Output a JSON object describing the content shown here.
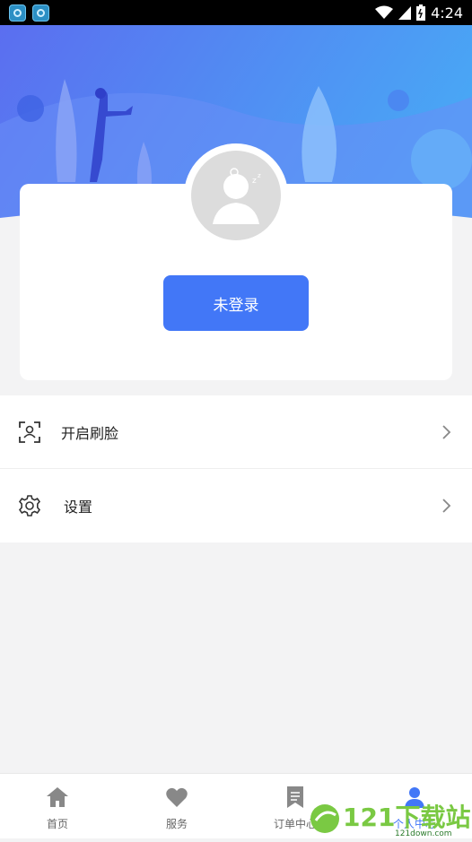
{
  "status_bar": {
    "time": "4:24"
  },
  "profile": {
    "login_button_label": "未登录"
  },
  "menu": {
    "items": [
      {
        "label": "开启刷脸",
        "icon": "face-scan-icon"
      },
      {
        "label": "设置",
        "icon": "gear-icon"
      }
    ]
  },
  "tabbar": {
    "tabs": [
      {
        "label": "首页",
        "icon": "home-icon"
      },
      {
        "label": "服务",
        "icon": "heart-icon"
      },
      {
        "label": "订单中心",
        "icon": "order-icon"
      },
      {
        "label": "个人中心",
        "icon": "person-icon",
        "active": true
      }
    ]
  },
  "watermark": {
    "text": "121下载站",
    "subtext": "121down.com"
  },
  "colors": {
    "accent": "#4277f7",
    "hero_start": "#5b6ef0",
    "hero_end": "#49a6f5",
    "background": "#f3f3f4"
  }
}
